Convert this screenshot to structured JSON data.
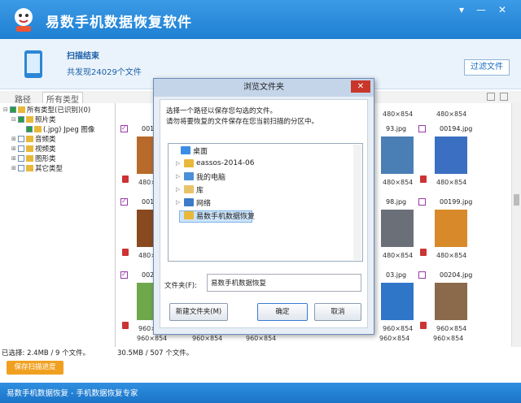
{
  "app": {
    "title": "易数手机数据恢复软件"
  },
  "window_controls": {
    "menu": "▾",
    "minimize": "—",
    "close": "✕"
  },
  "scan": {
    "title": "扫描结束",
    "count": "共发现24029个文件",
    "filter_label": "过滤文件"
  },
  "tabs": [
    {
      "label": "路径"
    },
    {
      "label": "所有类型"
    }
  ],
  "tree": [
    {
      "label": "所有类型(已识别)(0)",
      "indent": 0,
      "checked": true,
      "expander": "⊟"
    },
    {
      "label": "照片类",
      "indent": 1,
      "checked": true,
      "expander": "⊟"
    },
    {
      "label": "(.jpg) Jpeg 图像",
      "indent": 2,
      "checked": true,
      "expander": ""
    },
    {
      "label": "音频类",
      "indent": 1,
      "checked": false,
      "expander": "⊞"
    },
    {
      "label": "视频类",
      "indent": 1,
      "checked": false,
      "expander": "⊞"
    },
    {
      "label": "图形类",
      "indent": 1,
      "checked": false,
      "expander": "⊞"
    },
    {
      "label": "其它类型",
      "indent": 1,
      "checked": false,
      "expander": "⊞"
    }
  ],
  "grid": {
    "row0": [
      {
        "dim": "480×854"
      },
      {
        "dim": "480×854"
      }
    ],
    "cells": [
      {
        "name": "001",
        "dim": "480×8",
        "checked": true,
        "color": "#b86a2a"
      },
      {
        "name": "93.jpg",
        "dim": "480×854",
        "checked": false,
        "color": "#4a7fb5"
      },
      {
        "name": "00194.jpg",
        "dim": "480×854",
        "checked": false,
        "color": "#3b6fc2"
      },
      {
        "name": "001",
        "dim": "480×8",
        "checked": true,
        "color": "#8a4a1f"
      },
      {
        "name": "98.jpg",
        "dim": "480×854",
        "checked": false,
        "color": "#6b6f78"
      },
      {
        "name": "00199.jpg",
        "dim": "480×854",
        "checked": false,
        "color": "#d88a2a"
      },
      {
        "name": "002",
        "dim": "960×854",
        "checked": true,
        "color": "#6fa84a"
      },
      {
        "name": "03.jpg",
        "dim": "960×854",
        "checked": false,
        "color": "#2f76c8"
      },
      {
        "name": "00204.jpg",
        "dim": "960×854",
        "checked": false,
        "color": "#8a6a4a"
      }
    ],
    "bottom_dims": [
      "960×854",
      "960×854",
      "960×854",
      "960×854",
      "960×854"
    ]
  },
  "status": {
    "selected": "已选择: 2.4MB / 9 个文件。",
    "total": "30.5MB / 507 个文件。"
  },
  "save_label": "保存扫描进度",
  "footer": {
    "text": "易数手机数据恢复 - 手机数据恢复专家"
  },
  "dialog": {
    "title": "浏览文件夹",
    "close": "✕",
    "message1": "选择一个路径以保存您勾选的文件。",
    "message2": "请勿将要恢复的文件保存在您当前扫描的分区中。",
    "folders": [
      {
        "label": "桌面",
        "arrow": "",
        "color": "#3a8ee6",
        "indent": 0
      },
      {
        "label": "eassos-2014-06",
        "arrow": "▷",
        "color": "#e8b83a",
        "indent": 1
      },
      {
        "label": "我的电脑",
        "arrow": "▷",
        "color": "#4a90d9",
        "indent": 1
      },
      {
        "label": "库",
        "arrow": "▷",
        "color": "#e8c36a",
        "indent": 1
      },
      {
        "label": "网络",
        "arrow": "▷",
        "color": "#3b7bc8",
        "indent": 1
      },
      {
        "label": "易数手机数据恢复",
        "arrow": "",
        "color": "#e8b83a",
        "indent": 1
      }
    ],
    "folder_label": "文件夹(F):",
    "folder_value": "易数手机数据恢复",
    "new_folder": "新建文件夹(M)",
    "ok": "确定",
    "cancel": "取消"
  }
}
